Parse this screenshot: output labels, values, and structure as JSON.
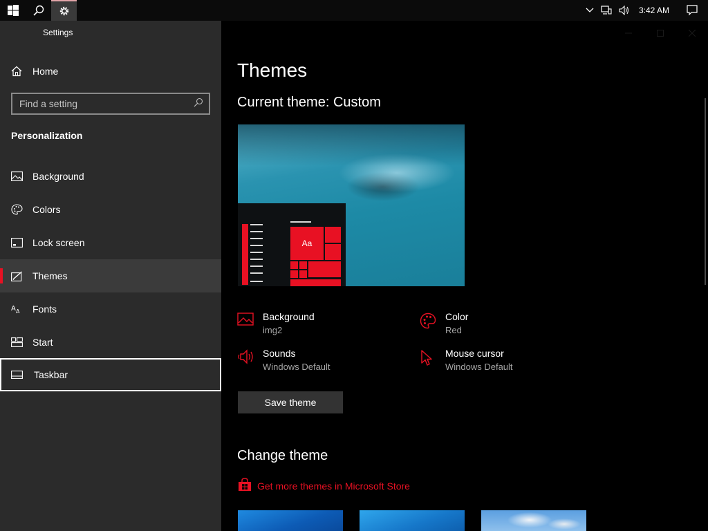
{
  "taskbar": {
    "icons": [
      "windows-start-icon",
      "search-icon",
      "settings-gear-icon"
    ],
    "tray_icons": [
      "chevron-up-icon",
      "network-icon",
      "volume-icon"
    ],
    "clock": "3:42 AM",
    "notification_icon": "action-center-icon"
  },
  "sidebar": {
    "app_title": "Settings",
    "home_label": "Home",
    "search_placeholder": "Find a setting",
    "section_title": "Personalization",
    "items": [
      {
        "label": "Background",
        "icon": "picture-icon"
      },
      {
        "label": "Colors",
        "icon": "palette-icon"
      },
      {
        "label": "Lock screen",
        "icon": "lock-screen-icon"
      },
      {
        "label": "Themes",
        "icon": "themes-icon"
      },
      {
        "label": "Fonts",
        "icon": "fonts-icon"
      },
      {
        "label": "Start",
        "icon": "start-icon"
      },
      {
        "label": "Taskbar",
        "icon": "taskbar-icon"
      }
    ],
    "selected": "Themes",
    "focused": "Taskbar"
  },
  "main": {
    "title": "Themes",
    "current_theme": "Current theme: Custom",
    "preview_tile_text": "Aa",
    "properties": [
      {
        "name": "Background",
        "value": "img2",
        "icon": "picture-icon"
      },
      {
        "name": "Color",
        "value": "Red",
        "icon": "palette-icon"
      },
      {
        "name": "Sounds",
        "value": "Windows Default",
        "icon": "speaker-icon"
      },
      {
        "name": "Mouse cursor",
        "value": "Windows Default",
        "icon": "cursor-icon"
      }
    ],
    "save_button": "Save theme",
    "change_theme_title": "Change theme",
    "store_link": "Get more themes in Microsoft Store"
  },
  "colors": {
    "accent": "#e81123",
    "sidebar_bg": "#2b2b2b",
    "main_bg": "#000000",
    "secondary_text": "#a6a6a6"
  }
}
